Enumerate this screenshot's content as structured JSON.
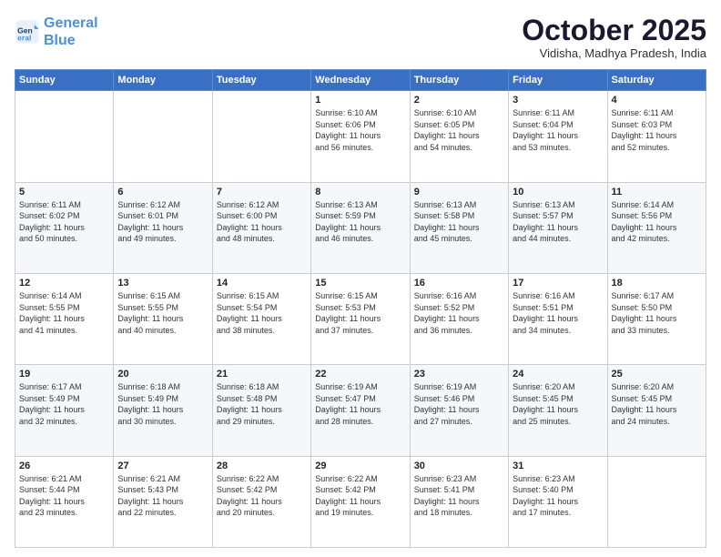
{
  "header": {
    "logo_line1": "General",
    "logo_line2": "Blue",
    "month_title": "October 2025",
    "subtitle": "Vidisha, Madhya Pradesh, India"
  },
  "days_of_week": [
    "Sunday",
    "Monday",
    "Tuesday",
    "Wednesday",
    "Thursday",
    "Friday",
    "Saturday"
  ],
  "weeks": [
    [
      {
        "day": "",
        "content": ""
      },
      {
        "day": "",
        "content": ""
      },
      {
        "day": "",
        "content": ""
      },
      {
        "day": "1",
        "content": "Sunrise: 6:10 AM\nSunset: 6:06 PM\nDaylight: 11 hours\nand 56 minutes."
      },
      {
        "day": "2",
        "content": "Sunrise: 6:10 AM\nSunset: 6:05 PM\nDaylight: 11 hours\nand 54 minutes."
      },
      {
        "day": "3",
        "content": "Sunrise: 6:11 AM\nSunset: 6:04 PM\nDaylight: 11 hours\nand 53 minutes."
      },
      {
        "day": "4",
        "content": "Sunrise: 6:11 AM\nSunset: 6:03 PM\nDaylight: 11 hours\nand 52 minutes."
      }
    ],
    [
      {
        "day": "5",
        "content": "Sunrise: 6:11 AM\nSunset: 6:02 PM\nDaylight: 11 hours\nand 50 minutes."
      },
      {
        "day": "6",
        "content": "Sunrise: 6:12 AM\nSunset: 6:01 PM\nDaylight: 11 hours\nand 49 minutes."
      },
      {
        "day": "7",
        "content": "Sunrise: 6:12 AM\nSunset: 6:00 PM\nDaylight: 11 hours\nand 48 minutes."
      },
      {
        "day": "8",
        "content": "Sunrise: 6:13 AM\nSunset: 5:59 PM\nDaylight: 11 hours\nand 46 minutes."
      },
      {
        "day": "9",
        "content": "Sunrise: 6:13 AM\nSunset: 5:58 PM\nDaylight: 11 hours\nand 45 minutes."
      },
      {
        "day": "10",
        "content": "Sunrise: 6:13 AM\nSunset: 5:57 PM\nDaylight: 11 hours\nand 44 minutes."
      },
      {
        "day": "11",
        "content": "Sunrise: 6:14 AM\nSunset: 5:56 PM\nDaylight: 11 hours\nand 42 minutes."
      }
    ],
    [
      {
        "day": "12",
        "content": "Sunrise: 6:14 AM\nSunset: 5:55 PM\nDaylight: 11 hours\nand 41 minutes."
      },
      {
        "day": "13",
        "content": "Sunrise: 6:15 AM\nSunset: 5:55 PM\nDaylight: 11 hours\nand 40 minutes."
      },
      {
        "day": "14",
        "content": "Sunrise: 6:15 AM\nSunset: 5:54 PM\nDaylight: 11 hours\nand 38 minutes."
      },
      {
        "day": "15",
        "content": "Sunrise: 6:15 AM\nSunset: 5:53 PM\nDaylight: 11 hours\nand 37 minutes."
      },
      {
        "day": "16",
        "content": "Sunrise: 6:16 AM\nSunset: 5:52 PM\nDaylight: 11 hours\nand 36 minutes."
      },
      {
        "day": "17",
        "content": "Sunrise: 6:16 AM\nSunset: 5:51 PM\nDaylight: 11 hours\nand 34 minutes."
      },
      {
        "day": "18",
        "content": "Sunrise: 6:17 AM\nSunset: 5:50 PM\nDaylight: 11 hours\nand 33 minutes."
      }
    ],
    [
      {
        "day": "19",
        "content": "Sunrise: 6:17 AM\nSunset: 5:49 PM\nDaylight: 11 hours\nand 32 minutes."
      },
      {
        "day": "20",
        "content": "Sunrise: 6:18 AM\nSunset: 5:49 PM\nDaylight: 11 hours\nand 30 minutes."
      },
      {
        "day": "21",
        "content": "Sunrise: 6:18 AM\nSunset: 5:48 PM\nDaylight: 11 hours\nand 29 minutes."
      },
      {
        "day": "22",
        "content": "Sunrise: 6:19 AM\nSunset: 5:47 PM\nDaylight: 11 hours\nand 28 minutes."
      },
      {
        "day": "23",
        "content": "Sunrise: 6:19 AM\nSunset: 5:46 PM\nDaylight: 11 hours\nand 27 minutes."
      },
      {
        "day": "24",
        "content": "Sunrise: 6:20 AM\nSunset: 5:45 PM\nDaylight: 11 hours\nand 25 minutes."
      },
      {
        "day": "25",
        "content": "Sunrise: 6:20 AM\nSunset: 5:45 PM\nDaylight: 11 hours\nand 24 minutes."
      }
    ],
    [
      {
        "day": "26",
        "content": "Sunrise: 6:21 AM\nSunset: 5:44 PM\nDaylight: 11 hours\nand 23 minutes."
      },
      {
        "day": "27",
        "content": "Sunrise: 6:21 AM\nSunset: 5:43 PM\nDaylight: 11 hours\nand 22 minutes."
      },
      {
        "day": "28",
        "content": "Sunrise: 6:22 AM\nSunset: 5:42 PM\nDaylight: 11 hours\nand 20 minutes."
      },
      {
        "day": "29",
        "content": "Sunrise: 6:22 AM\nSunset: 5:42 PM\nDaylight: 11 hours\nand 19 minutes."
      },
      {
        "day": "30",
        "content": "Sunrise: 6:23 AM\nSunset: 5:41 PM\nDaylight: 11 hours\nand 18 minutes."
      },
      {
        "day": "31",
        "content": "Sunrise: 6:23 AM\nSunset: 5:40 PM\nDaylight: 11 hours\nand 17 minutes."
      },
      {
        "day": "",
        "content": ""
      }
    ]
  ]
}
